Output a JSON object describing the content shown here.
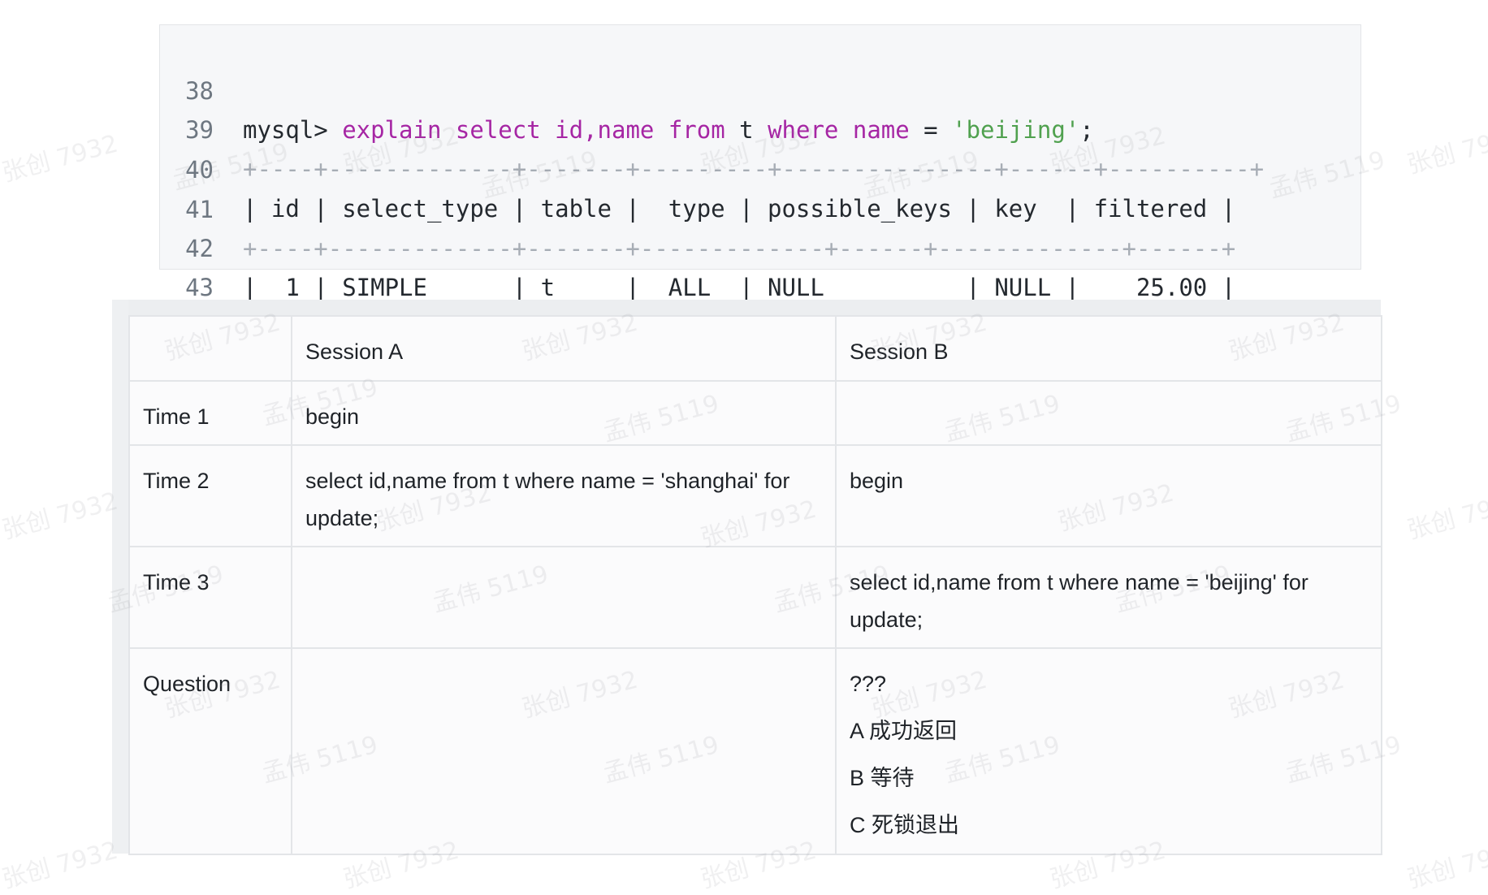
{
  "code": {
    "lines": [
      {
        "num": "38",
        "prompt": "mysql> ",
        "explain": "explain",
        "select": "select",
        "cols": "id,name",
        "from": "from",
        "tbl": "t",
        "where": "where",
        "col": "name",
        "eq": "=",
        "str": "'beijing'",
        "semi": ";"
      },
      {
        "num": "39",
        "text": "+----+-------------+-------+---------+---------------+------+----------+"
      },
      {
        "num": "40",
        "text": "| id | select_type | table |  type | possible_keys | key  | filtered |"
      },
      {
        "num": "41",
        "text": "+----+-------------+-------+-------------+------+-------------+------+"
      },
      {
        "num": "42",
        "text": "|  1 | SIMPLE      | t     |  ALL  | NULL          | NULL |    25.00 |"
      },
      {
        "num": "43",
        "text": "+----+-------------+-------+-------------+------+-------------+------+"
      }
    ]
  },
  "table": {
    "headers": [
      "",
      "Session A",
      "Session B"
    ],
    "rows": [
      {
        "time": "Time 1",
        "a": "begin",
        "b": ""
      },
      {
        "time": "Time 2",
        "a": "select id,name from t where name = 'shanghai' for update;",
        "b": "begin"
      },
      {
        "time": "Time 3",
        "a": "",
        "b": "select id,name from t where name = 'beijing' for update;"
      }
    ],
    "question": {
      "label": "Question",
      "a": "",
      "options": [
        "???",
        "A 成功返回",
        "B  等待",
        "C 死锁退出"
      ]
    }
  },
  "watermarks": [
    "张创 7932",
    "孟伟 5119"
  ]
}
